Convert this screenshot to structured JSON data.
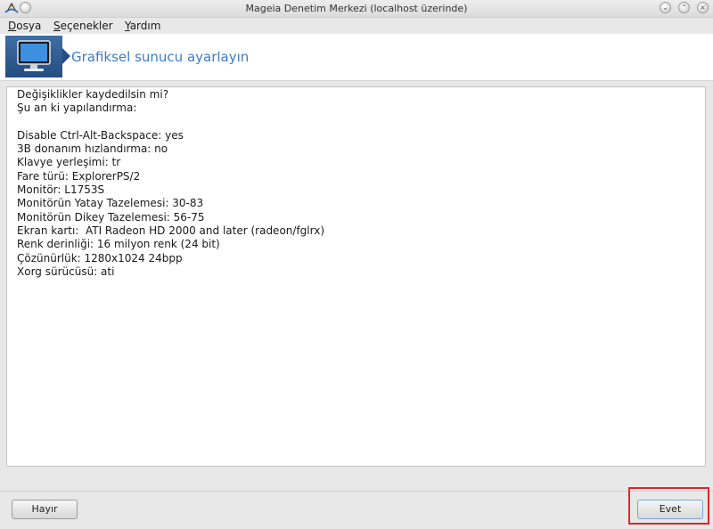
{
  "window": {
    "title": "Mageia Denetim Merkezi  (localhost üzerinde)",
    "buttons": [
      "minimize-button",
      "maximize-button",
      "close-button"
    ]
  },
  "menu": {
    "file_underline": "D",
    "file_rest": "osya",
    "options_underline": "S",
    "options_rest": "eçenekler",
    "help_underline": "Y",
    "help_rest": "ardım"
  },
  "header": {
    "title": "Grafiksel sunucu ayarlayın",
    "icon": "monitor-icon"
  },
  "content": {
    "lines": [
      "Değişiklikler kaydedilsin mi?",
      "Şu an ki yapılandırma:",
      "",
      "Disable Ctrl-Alt-Backspace: yes",
      "3B donanım hızlandırma: no",
      "Klavye yerleşimi: tr",
      "Fare türü: ExplorerPS/2",
      "Monitör: L1753S",
      "Monitörün Yatay Tazelemesi: 30-83",
      "Monitörün Dikey Tazelemesi: 56-75",
      "Ekran kartı:  ATI Radeon HD 2000 and later (radeon/fglrx)",
      "Renk derinliği: 16 milyon renk (24 bit)",
      "Çözünürlük: 1280x1024 24bpp",
      "Xorg sürücüsü: ati"
    ]
  },
  "buttons": {
    "no_label": "Hayır",
    "yes_label": "Evet"
  },
  "colors": {
    "accent": "#3f7bc4",
    "highlight": "#e0262b"
  }
}
